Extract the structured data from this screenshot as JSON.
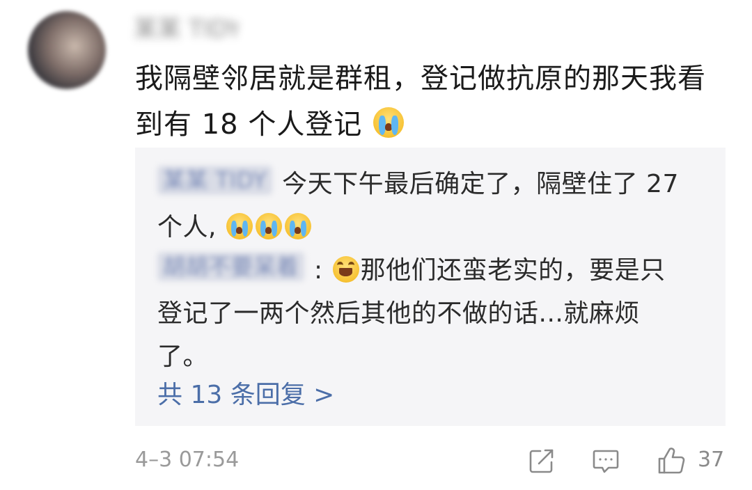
{
  "user": {
    "name": "某某 TIDY"
  },
  "comment": {
    "text_line1": "我隔壁邻居就是群租，登记做抗原的那天我看",
    "text_line2": "到有 18 个人登记",
    "emoji": "crying-face"
  },
  "replies": [
    {
      "author": "某某 TIDY",
      "text_line1": "今天下午最后确定了，隔壁住了 27",
      "text_line2": "个人,",
      "emojis": [
        "crying-face",
        "crying-face",
        "crying-face"
      ]
    },
    {
      "author": "胡胡不要呆着",
      "separator": ":",
      "emoji": "laughing-crying-face",
      "text_line1": "那他们还蛮老实的，要是只",
      "text_line2": "登记了一两个然后其他的不做的话...就麻烦",
      "text_line3": "了。"
    }
  ],
  "more_replies": "共 13 条回复 >",
  "footer": {
    "timestamp": "4–3 07:54",
    "like_count": "37"
  },
  "colors": {
    "link": "#4b6ea8",
    "reply_bg": "#f5f5f7",
    "meta_text": "#9a9a9a"
  }
}
